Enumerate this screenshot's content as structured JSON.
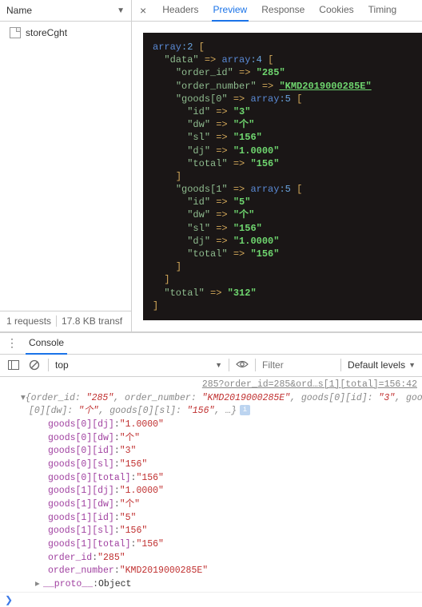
{
  "leftPanel": {
    "header": "Name",
    "requestItem": "storeCght",
    "footer": {
      "requests": "1 requests",
      "transfer": "17.8 KB transf"
    }
  },
  "tabs": {
    "close": "×",
    "headers": "Headers",
    "preview": "Preview",
    "response": "Response",
    "cookies": "Cookies",
    "timing": "Timing"
  },
  "preview": {
    "array_kw": "array",
    "arr2": "2",
    "arr4": "4",
    "arr5": "5",
    "data_k": "data",
    "order_id_k": "order_id",
    "order_id_v": "285",
    "order_number_k": "order_number",
    "order_number_v": "KMD2019000285E",
    "goods0": "goods[0",
    "goods1": "goods[1",
    "id_k": "id",
    "id0_v": "3",
    "id1_v": "5",
    "dw_k": "dw",
    "dw_v": "个",
    "sl_k": "sl",
    "sl_v": "156",
    "dj_k": "dj",
    "dj_v": "1.0000",
    "total_k": "total",
    "total_item_v": "156",
    "total_v": "312"
  },
  "console": {
    "title": "Console",
    "context": "top",
    "filterPlaceholder": "Filter",
    "levels": "Default levels",
    "linkLine": "285?order_id=285&ord…s[1][total]=156:42",
    "summary1_pre": "{order_id: ",
    "summary1_oid": "\"285\"",
    "summary1_on_k": ", order_number: ",
    "summary1_on_v": "\"KMD2019000285E\"",
    "summary1_g0id_k": ", goods[0][id]: ",
    "summary1_g0id_v": "\"3\"",
    "summary1_tail": ", goods",
    "summary2_pre": "[0][dw]: ",
    "summary2_dw_v": "\"个\"",
    "summary2_sl_k": ", goods[0][sl]: ",
    "summary2_sl_v": "\"156\"",
    "summary2_tail": ", …}",
    "rows": {
      "g0dj_k": "goods[0][dj]",
      "g0dj_v": "\"1.0000\"",
      "g0dw_k": "goods[0][dw]",
      "g0dw_v": "\"个\"",
      "g0id_k": "goods[0][id]",
      "g0id_v": "\"3\"",
      "g0sl_k": "goods[0][sl]",
      "g0sl_v": "\"156\"",
      "g0tot_k": "goods[0][total]",
      "g0tot_v": "\"156\"",
      "g1dj_k": "goods[1][dj]",
      "g1dj_v": "\"1.0000\"",
      "g1dw_k": "goods[1][dw]",
      "g1dw_v": "\"个\"",
      "g1id_k": "goods[1][id]",
      "g1id_v": "\"5\"",
      "g1sl_k": "goods[1][sl]",
      "g1sl_v": "\"156\"",
      "g1tot_k": "goods[1][total]",
      "g1tot_v": "\"156\"",
      "oid_k": "order_id",
      "oid_v": "\"285\"",
      "onum_k": "order_number",
      "onum_v": "\"KMD2019000285E\"",
      "proto_k": "__proto__",
      "proto_v": "Object"
    },
    "prompt": "❯"
  }
}
